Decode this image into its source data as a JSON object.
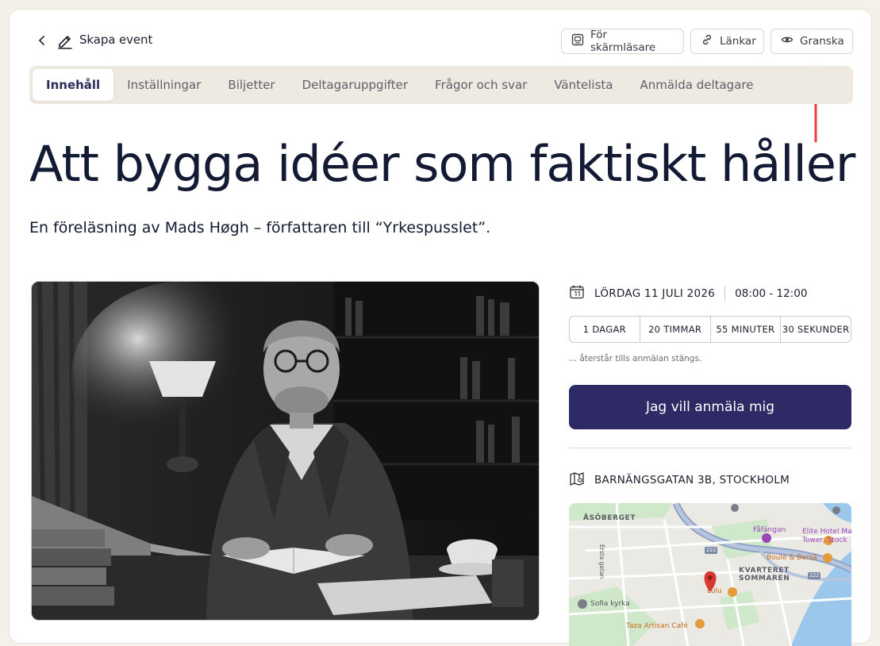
{
  "header": {
    "title": "Skapa event",
    "buttons": {
      "screen_reader": "För skärmläsare",
      "links": "Länkar",
      "preview": "Granska"
    }
  },
  "tabs": [
    {
      "label": "Innehåll",
      "active": true
    },
    {
      "label": "Inställningar",
      "active": false
    },
    {
      "label": "Biljetter",
      "active": false
    },
    {
      "label": "Deltagaruppgifter",
      "active": false
    },
    {
      "label": "Frågor och svar",
      "active": false
    },
    {
      "label": "Väntelista",
      "active": false
    },
    {
      "label": "Anmälda deltagare",
      "active": false
    }
  ],
  "event": {
    "headline": "Att bygga idéer som faktiskt håller",
    "subtitle": "En föreläsning av Mads Høgh – författaren till “Yrkespusslet”.",
    "date": "LÖRDAG 11 JULI 2026",
    "time": "08:00 - 12:00",
    "countdown": [
      "1 DAGAR",
      "20 TIMMAR",
      "55 MINUTER",
      "30 SEKUNDER"
    ],
    "remaining_text": "... återstår tills anmälan stängs.",
    "cta_label": "Jag vill anmäla mig",
    "address": "BARNÄNGSGATAN 3B, STOCKHOLM"
  },
  "map": {
    "labels": {
      "area1": "ÅSÖBERGET",
      "area2_line1": "KVARTERET",
      "area2_line2": "SOMMAREN",
      "street": "Ersta gatan",
      "poi_fafangan": "Fåfängan",
      "poi_hotel_line1": "Elite Hotel Ma",
      "poi_hotel_line2": "Tower, Stock",
      "poi_boule": "Boule & Bersã",
      "poi_lulu": "Lulu",
      "poi_church": "Sofia kyrka",
      "poi_cafe": "Taza Artisan Café",
      "road_222a": "222",
      "road_222b": "222"
    }
  },
  "colors": {
    "primary": "#2e2a66",
    "background": "#f4f1ea",
    "tabs_bg": "#eeeae1",
    "arrow": "#f23c3c"
  }
}
